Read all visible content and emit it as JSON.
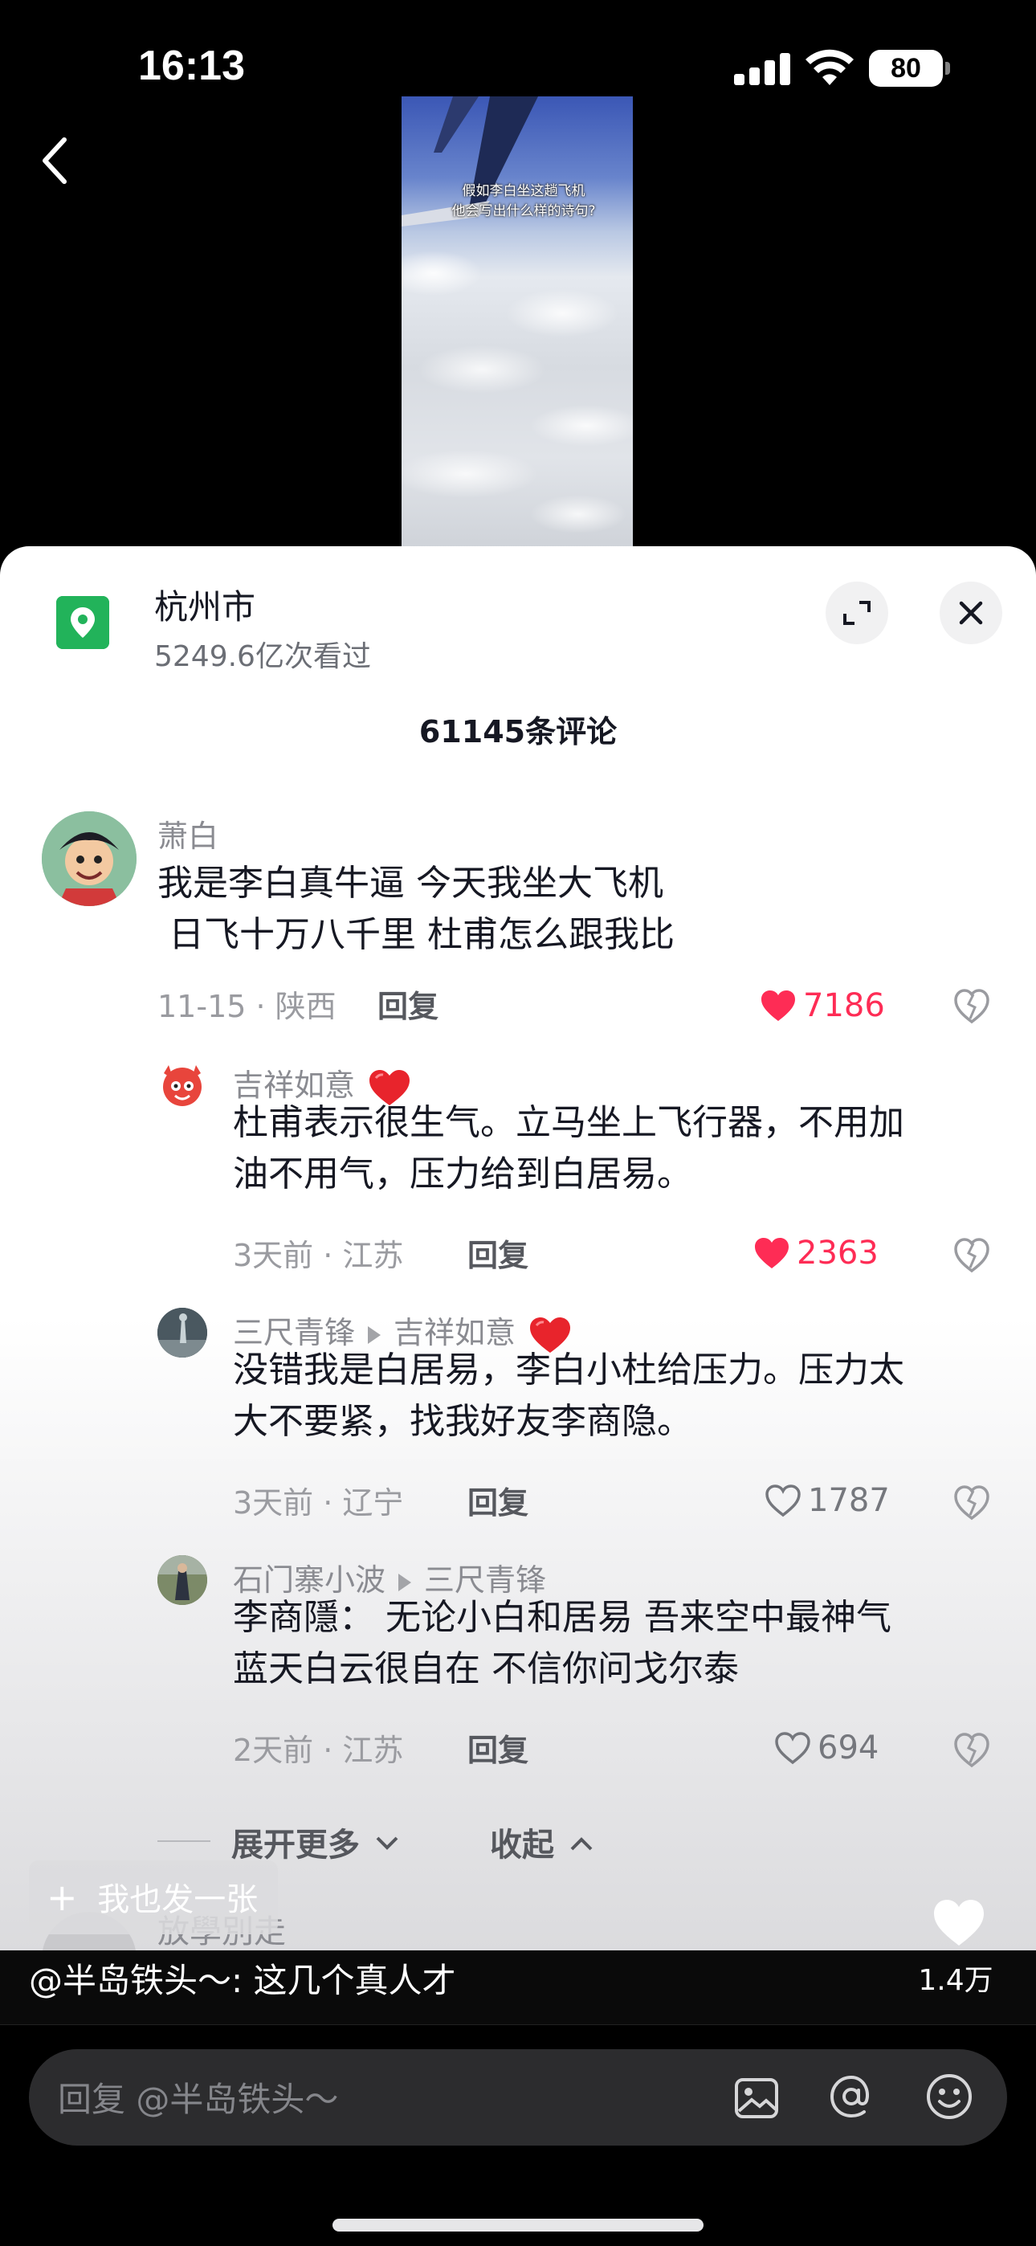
{
  "status_bar": {
    "time": "16:13",
    "battery": "80"
  },
  "video": {
    "caption_line1": "假如李白坐这趟飞机",
    "caption_line2": "他会写出什么样的诗句?"
  },
  "location": {
    "name": "杭州市",
    "views": "5249.6亿次看过"
  },
  "comments_header": "61145条评论",
  "comments": [
    {
      "user": "萧白",
      "text_line1": "我是李白真牛逼 今天我坐大飞机",
      "text_line2": " 日飞十万八千里 杜甫怎么跟我比",
      "meta": "11-15 · 陕西",
      "reply_label": "回复",
      "likes": "7186",
      "liked": true
    },
    {
      "user": "吉祥如意",
      "text_line1": "杜甫表示很生气。立马坐上飞行器，不用加",
      "text_line2": "油不用气，压力给到白居易。",
      "meta": "3天前 · 江苏",
      "reply_label": "回复",
      "likes": "2363",
      "liked": true
    },
    {
      "user": "三尺青锋",
      "reply_to": "吉祥如意",
      "text_line1": "没错我是白居易，李白小杜给压力。压力太",
      "text_line2": "大不要紧，找我好友李商隐。",
      "meta": "3天前 · 辽宁",
      "reply_label": "回复",
      "likes": "1787",
      "liked": false
    },
    {
      "user": "石门寨小波",
      "reply_to": "三尺青锋",
      "text_line1": "李商隱： 无论小白和居易 吾来空中最神气",
      "text_line2": "蓝天白云很自在 不信你问戈尔泰",
      "meta": "2天前 · 江苏",
      "reply_label": "回复",
      "likes": "694",
      "liked": false
    }
  ],
  "expand_more": "展开更多",
  "collapse": "收起",
  "post_too": "我也发一张",
  "next_commenter": "放學別走",
  "video_caption": "@半岛铁头～: 这几个真人才",
  "like_total": "1.4万",
  "reply_input": {
    "placeholder": "回复 @半岛铁头～"
  },
  "colors": {
    "accent_red": "#fe2c55",
    "location_green": "#22b35a"
  }
}
